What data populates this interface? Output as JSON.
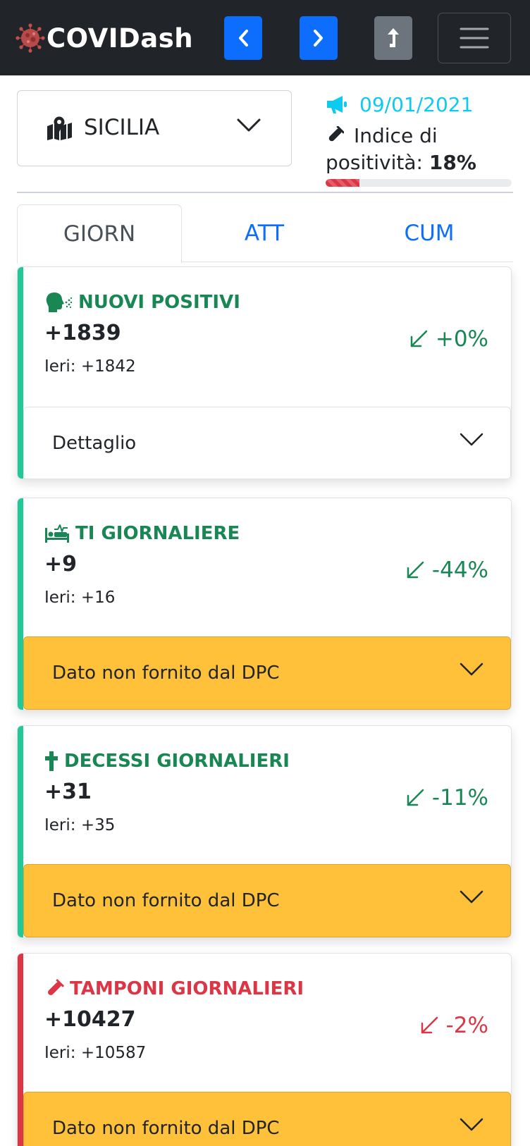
{
  "navbar": {
    "brand": "COVIDash",
    "prev_icon": "chevron-left-icon",
    "next_icon": "chevron-right-icon",
    "share_icon": "share-up-arrow-icon",
    "menu_icon": "hamburger-menu-icon"
  },
  "region": {
    "selected": "SICILIA",
    "icon": "map-marked-icon"
  },
  "info": {
    "date": "09/01/2021",
    "positivity_label_line1": "Indice di",
    "positivity_label_line2": "positività:",
    "positivity_value": "18%",
    "positivity_fraction": 0.18
  },
  "tabs": [
    {
      "label": "GIORN",
      "active": true
    },
    {
      "label": "ATT",
      "active": false
    },
    {
      "label": "CUM",
      "active": false
    }
  ],
  "cards": [
    {
      "title": "NUOVI POSITIVI",
      "icon": "head-sneeze-icon",
      "value": "+1839",
      "yesterday": "Ieri: +1842",
      "trend": "+0%",
      "trend_icon": "arrow-down-left-icon",
      "status": "green",
      "accordion": "Dettaglio",
      "accordion_style": "white"
    },
    {
      "title": "TI GIORNALIERE",
      "icon": "procedures-bed-icon",
      "value": "+9",
      "yesterday": "Ieri: +16",
      "trend": "-44%",
      "trend_icon": "arrow-down-left-icon",
      "status": "green",
      "accordion": "Dato non fornito dal DPC",
      "accordion_style": "warning"
    },
    {
      "title": "DECESSI GIORNALIERI",
      "icon": "cross-icon",
      "value": "+31",
      "yesterday": "Ieri: +35",
      "trend": "-11%",
      "trend_icon": "arrow-down-left-icon",
      "status": "green",
      "accordion": "Dato non fornito dal DPC",
      "accordion_style": "warning"
    },
    {
      "title": "TAMPONI GIORNALIERI",
      "icon": "vial-icon",
      "value": "+10427",
      "yesterday": "Ieri: +10587",
      "trend": "-2%",
      "trend_icon": "arrow-down-left-icon",
      "status": "red",
      "accordion": "Dato non fornito dal DPC",
      "accordion_style": "warning"
    }
  ],
  "colors": {
    "navbar": "#212529",
    "primary": "#0d6efd",
    "secondary": "#6c757d",
    "info": "#0dcaf0",
    "success": "#198754",
    "success_border": "#20c997",
    "danger": "#dc3545",
    "warning": "#ffc03a"
  }
}
